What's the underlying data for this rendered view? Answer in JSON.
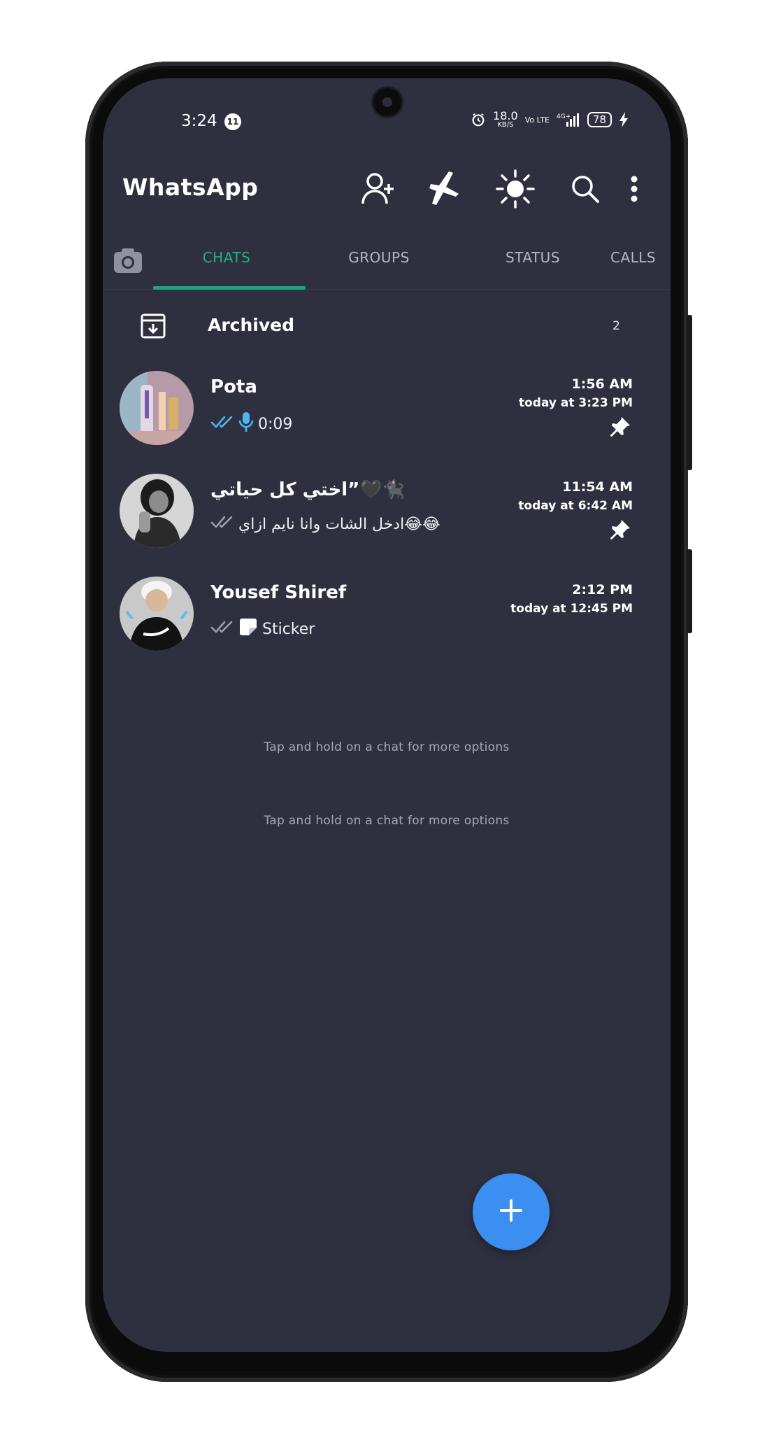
{
  "status_bar": {
    "time": "3:24",
    "notification_count": "11",
    "net_speed_value": "18.0",
    "net_speed_unit": "KB/S",
    "volte": "Vo LTE",
    "network": "4G+",
    "battery": "78"
  },
  "app_bar": {
    "title": "WhatsApp",
    "icons": [
      "add-contact-icon",
      "airplane-icon",
      "brightness-icon",
      "search-icon",
      "more-vert-icon"
    ]
  },
  "tabs": [
    {
      "label": "CHATS",
      "active": true
    },
    {
      "label": "GROUPS",
      "active": false
    },
    {
      "label": "STATUS",
      "active": false
    },
    {
      "label": "CALLS",
      "active": false
    }
  ],
  "archived": {
    "label": "Archived",
    "count": "2"
  },
  "chats": [
    {
      "name": "Pota",
      "preview": "0:09",
      "preview_type": "voice",
      "time": "1:56 AM",
      "sub_time": "today at 3:23 PM",
      "pinned": true,
      "ticks_color": "#4fb6f0"
    },
    {
      "name": "اختي كل حياتي”🖤🐈‍⬛",
      "preview": "ادخل الشات وانا نايم ازاي😂😂",
      "preview_type": "text",
      "time": "11:54 AM",
      "sub_time": "today at 6:42 AM",
      "pinned": true,
      "ticks_color": "#9a9ca8"
    },
    {
      "name": "Yousef Shiref",
      "preview": "Sticker",
      "preview_type": "sticker",
      "time": "2:12 PM",
      "sub_time": "today at 12:45 PM",
      "pinned": false,
      "ticks_color": "#9a9ca8"
    }
  ],
  "hints": [
    "Tap and hold on a chat for more options",
    "Tap and hold on a chat for more options"
  ],
  "fab": {
    "icon": "plus-icon"
  },
  "colors": {
    "background": "#2f303f",
    "accent": "#1eb47d",
    "fab": "#3a8ff0",
    "read_ticks": "#4fb6f0"
  }
}
